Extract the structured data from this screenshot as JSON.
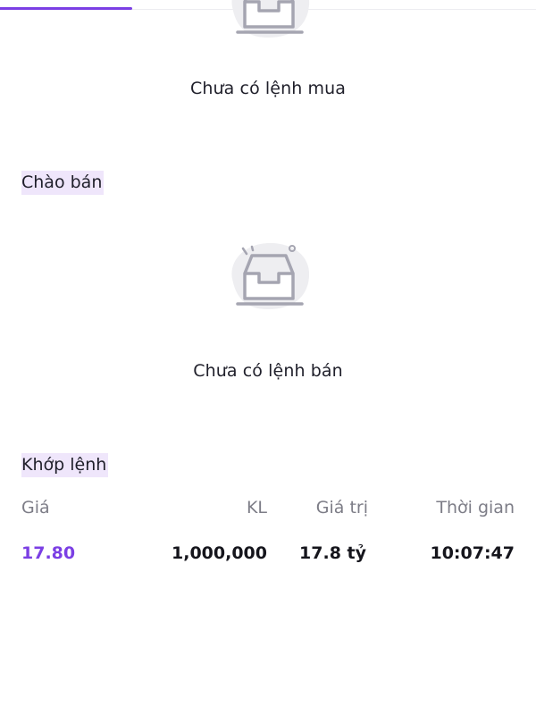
{
  "colors": {
    "accent": "#7b3fe4",
    "section_highlight": "#efe6fb",
    "illustration": "#eeeef1"
  },
  "buy_orders": {
    "empty_icon": "empty-inbox-icon",
    "empty_message": "Chưa có lệnh mua"
  },
  "ask_section": {
    "title": "Chào bán",
    "empty_icon": "empty-inbox-icon",
    "empty_message": "Chưa có lệnh bán"
  },
  "matched_section": {
    "title": "Khớp lệnh",
    "columns": {
      "price": "Giá",
      "volume": "KL",
      "value": "Giá trị",
      "time": "Thời gian"
    },
    "rows": [
      {
        "price": "17.80",
        "volume": "1,000,000",
        "value": "17.8 tỷ",
        "time": "10:07:47"
      }
    ]
  }
}
